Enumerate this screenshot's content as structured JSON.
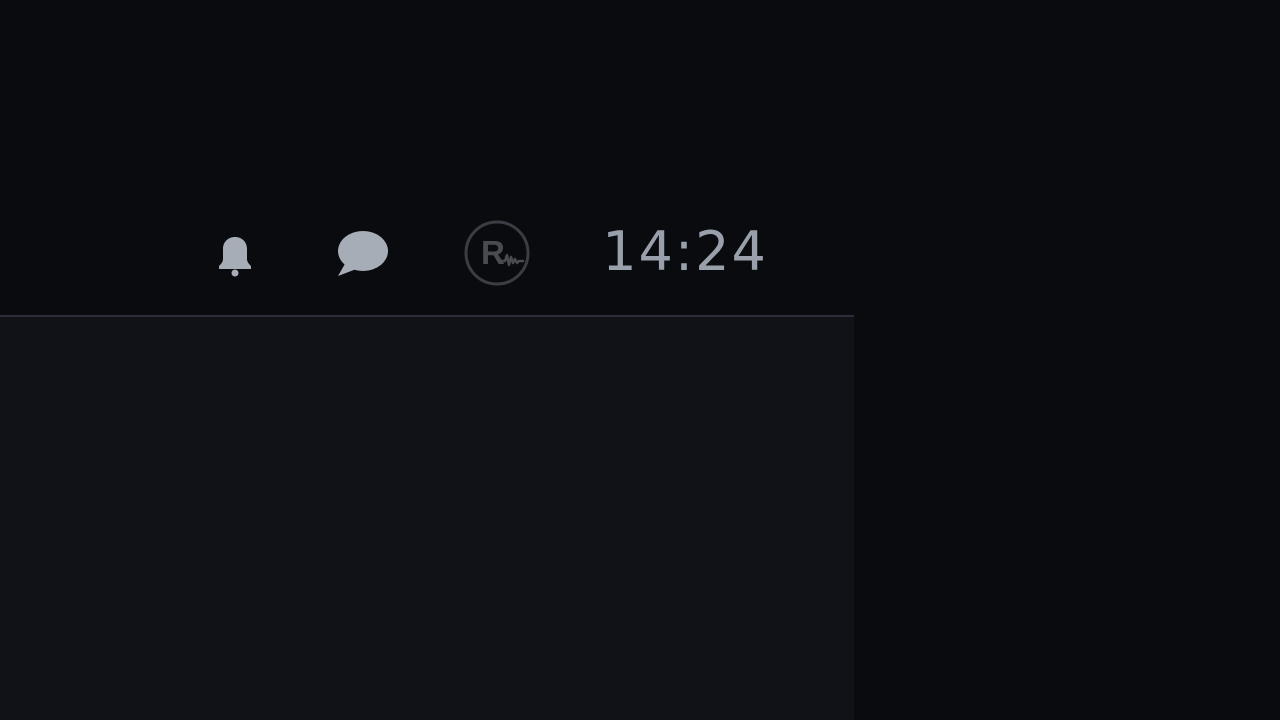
{
  "status_bar": {
    "clock": "14:24",
    "icons": {
      "notifications": "bell-icon",
      "messages": "chat-bubble-icon",
      "profile": "profile-badge-icon"
    },
    "profile_initial": "R"
  },
  "colors": {
    "background": "#0a0b0f",
    "panel": "#101217",
    "divider": "#2a2f39",
    "icon": "#a7adb7",
    "text": "#9aa0ab",
    "profile_ring": "#3a3d43",
    "profile_mark": "#4a4b4f"
  }
}
